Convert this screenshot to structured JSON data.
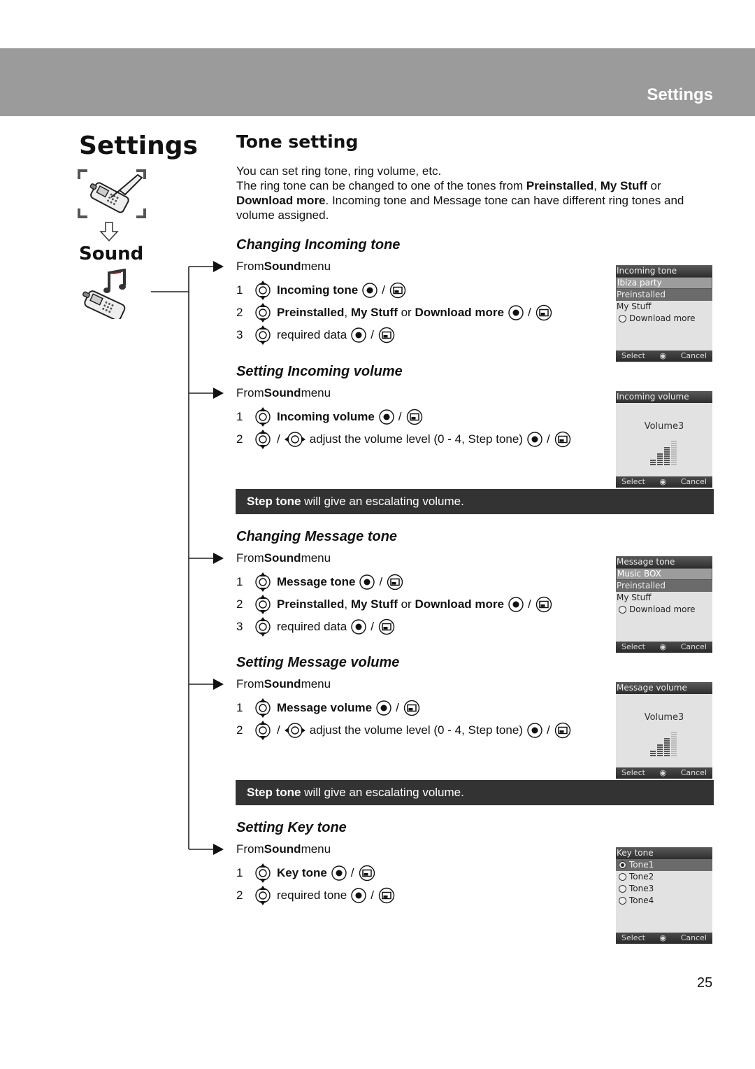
{
  "header": {
    "section_label": "Settings"
  },
  "sidebar": {
    "title": "Settings",
    "sub_label": "Sound",
    "icons": [
      "phone-settings-icon",
      "down-arrow-icon",
      "phone-music-icon"
    ]
  },
  "main": {
    "title": "Tone setting",
    "intro": {
      "line1": "You can set ring tone, ring volume, etc.",
      "p2_a": "The ring tone can be changed to one of the tones from ",
      "p2_b": "Preinstalled",
      "p2_c": ", ",
      "p2_d": "My Stuff",
      "p2_e": " or ",
      "p2_f": "Download more",
      "p2_g": ". Incoming tone and Message tone can have different ring tones and volume assigned."
    },
    "common": {
      "from_prefix": "From ",
      "from_bold": "Sound",
      "from_suffix": " menu",
      "slash": "/",
      "or": " or ",
      "comma": ", ",
      "preinstalled": "Preinstalled",
      "my_stuff": "My Stuff",
      "download_more": "Download more",
      "required_data": "required data",
      "required_tone": "required tone",
      "adjust_text": "adjust the volume level (0 - 4, Step tone)"
    },
    "sections": [
      {
        "title": "Changing Incoming tone",
        "steps": [
          {
            "num": "1",
            "label": "Incoming tone"
          },
          {
            "num": "2"
          },
          {
            "num": "3"
          }
        ],
        "screen": {
          "header": "Incoming tone",
          "rows": [
            "Ibiza party",
            "Preinstalled",
            "My Stuff",
            "Download more"
          ],
          "softkeys": {
            "left": "Select",
            "right": "Cancel"
          }
        }
      },
      {
        "title": "Setting Incoming volume",
        "steps": [
          {
            "num": "1",
            "label": "Incoming volume"
          },
          {
            "num": "2"
          }
        ],
        "screen": {
          "header": "Incoming volume",
          "center": "Volume3",
          "volume_level": 3,
          "volume_max": 4,
          "softkeys": {
            "left": "Select",
            "right": "Cancel"
          }
        },
        "note": {
          "bold": "Step tone",
          "rest": " will give an escalating volume."
        }
      },
      {
        "title": "Changing Message tone",
        "steps": [
          {
            "num": "1",
            "label": "Message tone"
          },
          {
            "num": "2"
          },
          {
            "num": "3"
          }
        ],
        "screen": {
          "header": "Message tone",
          "rows": [
            "Music BOX",
            "Preinstalled",
            "My Stuff",
            "Download more"
          ],
          "softkeys": {
            "left": "Select",
            "right": "Cancel"
          }
        }
      },
      {
        "title": "Setting Message volume",
        "steps": [
          {
            "num": "1",
            "label": "Message volume"
          },
          {
            "num": "2"
          }
        ],
        "screen": {
          "header": "Message volume",
          "center": "Volume3",
          "volume_level": 3,
          "volume_max": 4,
          "softkeys": {
            "left": "Select",
            "right": "Cancel"
          }
        },
        "note": {
          "bold": "Step tone",
          "rest": " will give an escalating volume."
        }
      },
      {
        "title": "Setting Key tone",
        "steps": [
          {
            "num": "1",
            "label": "Key tone"
          },
          {
            "num": "2"
          }
        ],
        "screen": {
          "header": "Key tone",
          "rows": [
            "Tone1",
            "Tone2",
            "Tone3",
            "Tone4"
          ],
          "selected": "Tone1",
          "softkeys": {
            "left": "Select",
            "right": "Cancel"
          }
        }
      }
    ]
  },
  "footer": {
    "page_number": "25"
  }
}
